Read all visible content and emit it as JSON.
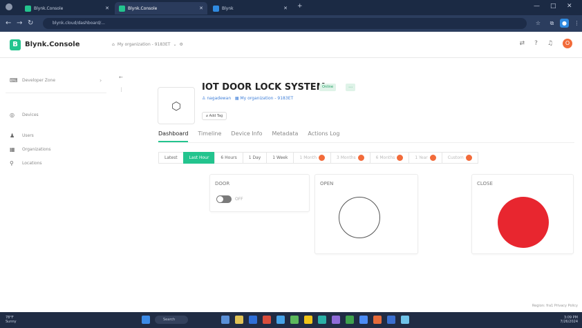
{
  "browser": {
    "tabs": [
      {
        "label": "Blynk.Console",
        "active": false
      },
      {
        "label": "Blynk.Console",
        "active": true
      },
      {
        "label": "Blynk",
        "active": false
      }
    ],
    "new_tab": "+",
    "url": "blynk.cloud/dashboard/...",
    "window_controls": [
      "—",
      "□",
      "✕"
    ]
  },
  "header": {
    "logo_text": "Blynk.Console",
    "breadcrumb_org": "My organization - 9183ET",
    "breadcrumb_sep": "⌄",
    "avatar_letter": "O"
  },
  "sidebar": {
    "items": [
      {
        "label": "Developer Zone",
        "icon": "code-icon"
      },
      {
        "label": "Devices",
        "icon": "devices-icon"
      },
      {
        "label": "Users",
        "icon": "users-icon"
      },
      {
        "label": "Organizations",
        "icon": "organizations-icon"
      },
      {
        "label": "Locations",
        "icon": "location-icon"
      }
    ]
  },
  "device": {
    "title": "IOT DOOR LOCK SYSTEM",
    "status_badge": "Online",
    "owner": "nagadewan",
    "organization": "My organization - 9183ET",
    "add_tag": "Add Tag"
  },
  "tabs": [
    "Dashboard",
    "Timeline",
    "Device Info",
    "Metadata",
    "Actions Log"
  ],
  "ranges": [
    {
      "label": "Latest",
      "state": "normal"
    },
    {
      "label": "Last Hour",
      "state": "selected"
    },
    {
      "label": "6 Hours",
      "state": "normal"
    },
    {
      "label": "1 Day",
      "state": "normal"
    },
    {
      "label": "1 Week",
      "state": "normal"
    },
    {
      "label": "1 Month",
      "state": "pro"
    },
    {
      "label": "3 Months",
      "state": "pro"
    },
    {
      "label": "6 Months",
      "state": "pro"
    },
    {
      "label": "1 Year",
      "state": "pro"
    },
    {
      "label": "Custom",
      "state": "pro"
    }
  ],
  "widgets": {
    "door": {
      "title": "DOOR",
      "switch_label": "OFF",
      "on": false
    },
    "open": {
      "title": "OPEN",
      "led_color": "#ffffff"
    },
    "close": {
      "title": "CLOSE",
      "led_color": "#e8262f"
    }
  },
  "footer_note": "Region: fra1  Privacy Policy",
  "taskbar": {
    "weather_temp": "78°F",
    "weather_text": "Sunny",
    "search": "Search",
    "time": "3:09 PM",
    "date": "7/26/2024"
  },
  "colors": {
    "accent": "#23c48e",
    "led_red": "#e8262f",
    "pro_badge": "#f26b3a",
    "browser_dark": "#1b2a44"
  }
}
